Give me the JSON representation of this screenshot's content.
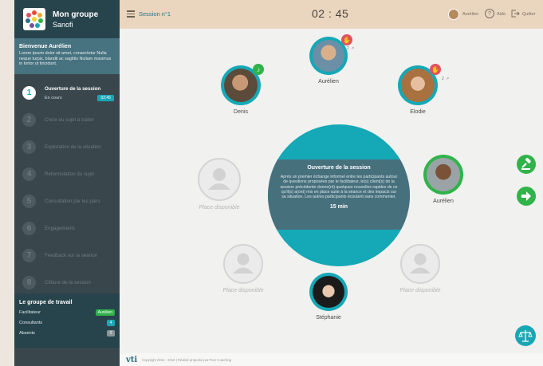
{
  "group": {
    "title": "Mon groupe",
    "subtitle": "Sanofi"
  },
  "welcome": {
    "title": "Bienvenue Aurélien",
    "text": "Lorem ipsum dolor sit amet, consectetur Nulla neque turpis, blandit ac sagittis Nullam maximus in tortor ut tincidunt."
  },
  "steps": [
    {
      "num": "1",
      "label": "Ouverture de la session",
      "status": "En cours",
      "time": "02:45"
    },
    {
      "num": "2",
      "label": "Choix du sujet à traiter"
    },
    {
      "num": "3",
      "label": "Exploration de la situation"
    },
    {
      "num": "4",
      "label": "Reformulation du sujet"
    },
    {
      "num": "5",
      "label": "Consultation par les pairs"
    },
    {
      "num": "6",
      "label": "Engagements"
    },
    {
      "num": "7",
      "label": "Feedback sur la séance"
    },
    {
      "num": "8",
      "label": "Clôture de la session"
    }
  ],
  "workgroup": {
    "title": "Le groupe de travail",
    "rows": [
      {
        "label": "Facilitateur",
        "value": "Aurélien",
        "color": "#2fb04a"
      },
      {
        "label": "Consultants",
        "value": "4",
        "color": "#17a8b5"
      },
      {
        "label": "Absents",
        "value": "0",
        "color": "#8a9497"
      }
    ]
  },
  "header": {
    "session": "Session n°1",
    "timer": "02 : 45",
    "user": "Aurélien",
    "help": "Aide",
    "quit": "Quitter"
  },
  "participants": {
    "top": {
      "name": "Aurélien",
      "count": "2"
    },
    "left": {
      "name": "Denis"
    },
    "right": {
      "name": "Elodie",
      "count": "2"
    },
    "facilitator": {
      "name": "Aurélien"
    },
    "bottom": {
      "name": "Stéphanie"
    }
  },
  "empty_slot_label": "Place disponible",
  "center": {
    "title": "Ouverture de la session",
    "text": "Après un premier échange informel entre les participants autour de questions proposées par le facilitateur, le(s) client(s) de la session précédente donne(nt) quelques nouvelles rapides de ce qu'il(s) a(ont) mis en place suite à la séance et des impacts sur sa situation. Les autres participants écoutent sans commenter.",
    "duration": "15 min"
  },
  "footer": {
    "logo": "vti",
    "text": "Copyright 2015 - 2016 | Réalisé propulsé par Peer Coaching"
  },
  "colors": {
    "teal": "#15a8b6",
    "green": "#31b34b",
    "pink": "#e0525f",
    "sidebar": "#39474c"
  }
}
